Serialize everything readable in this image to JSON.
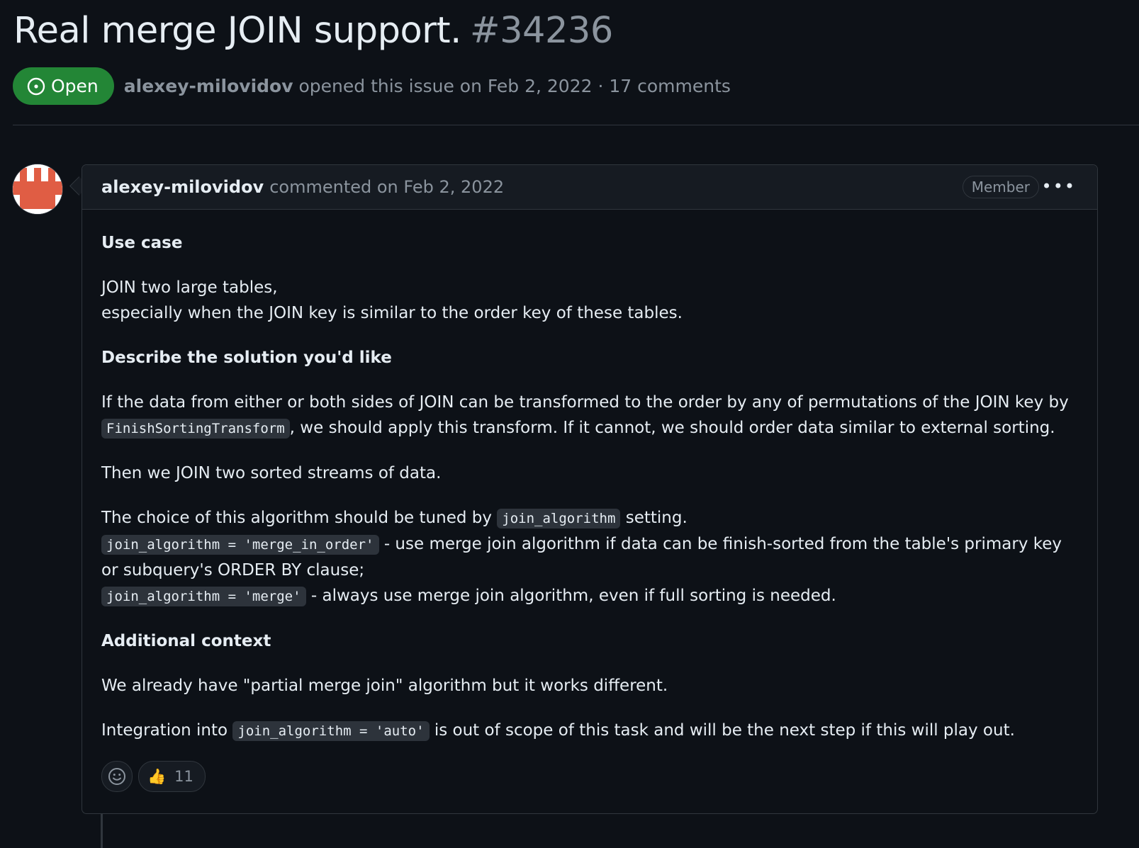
{
  "issue": {
    "title": "Real merge JOIN support.",
    "number": "#34236",
    "state_label": "Open",
    "author": "alexey-milovidov",
    "meta": "opened this issue on Feb 2, 2022 · 17 comments"
  },
  "comment": {
    "author": "alexey-milovidov",
    "action": "commented on Feb 2, 2022",
    "role_badge": "Member",
    "menu_icon": "kebab-horizontal-icon",
    "body": {
      "h_use_case": "Use case",
      "use_case_line1": "JOIN two large tables,",
      "use_case_line2": "especially when the JOIN key is similar to the order key of these tables.",
      "h_solution": "Describe the solution you'd like",
      "sol_p1_a": "If the data from either or both sides of JOIN can be transformed to the order by any of permutations of the JOIN key by",
      "sol_code1": "FinishSortingTransform",
      "sol_p1_b": ", we should apply this transform. If it cannot, we should order data similar to external sorting.",
      "sol_p2": "Then we JOIN two sorted streams of data.",
      "sol_p3_a": "The choice of this algorithm should be tuned by",
      "sol_code2": "join_algorithm",
      "sol_p3_b": "setting.",
      "sol_code3": "join_algorithm = 'merge_in_order'",
      "sol_p4_b": "- use merge join algorithm if data can be finish-sorted from the table's primary key or subquery's ORDER BY clause;",
      "sol_code4": "join_algorithm = 'merge'",
      "sol_p5_b": "- always use merge join algorithm, even if full sorting is needed.",
      "h_context": "Additional context",
      "ctx_p1": "We already have \"partial merge join\" algorithm but it works different.",
      "ctx_p2_a": "Integration into",
      "ctx_code": "join_algorithm = 'auto'",
      "ctx_p2_b": "is out of scope of this task and will be the next step if this will play out."
    },
    "reactions": {
      "add_icon": "smiley-icon",
      "thumbs_up_count": "11"
    }
  },
  "colors": {
    "background": "#0d1117",
    "open_badge": "#238636",
    "border": "#30363d",
    "muted_text": "#8b949e",
    "avatar_red": "#e05d44"
  }
}
